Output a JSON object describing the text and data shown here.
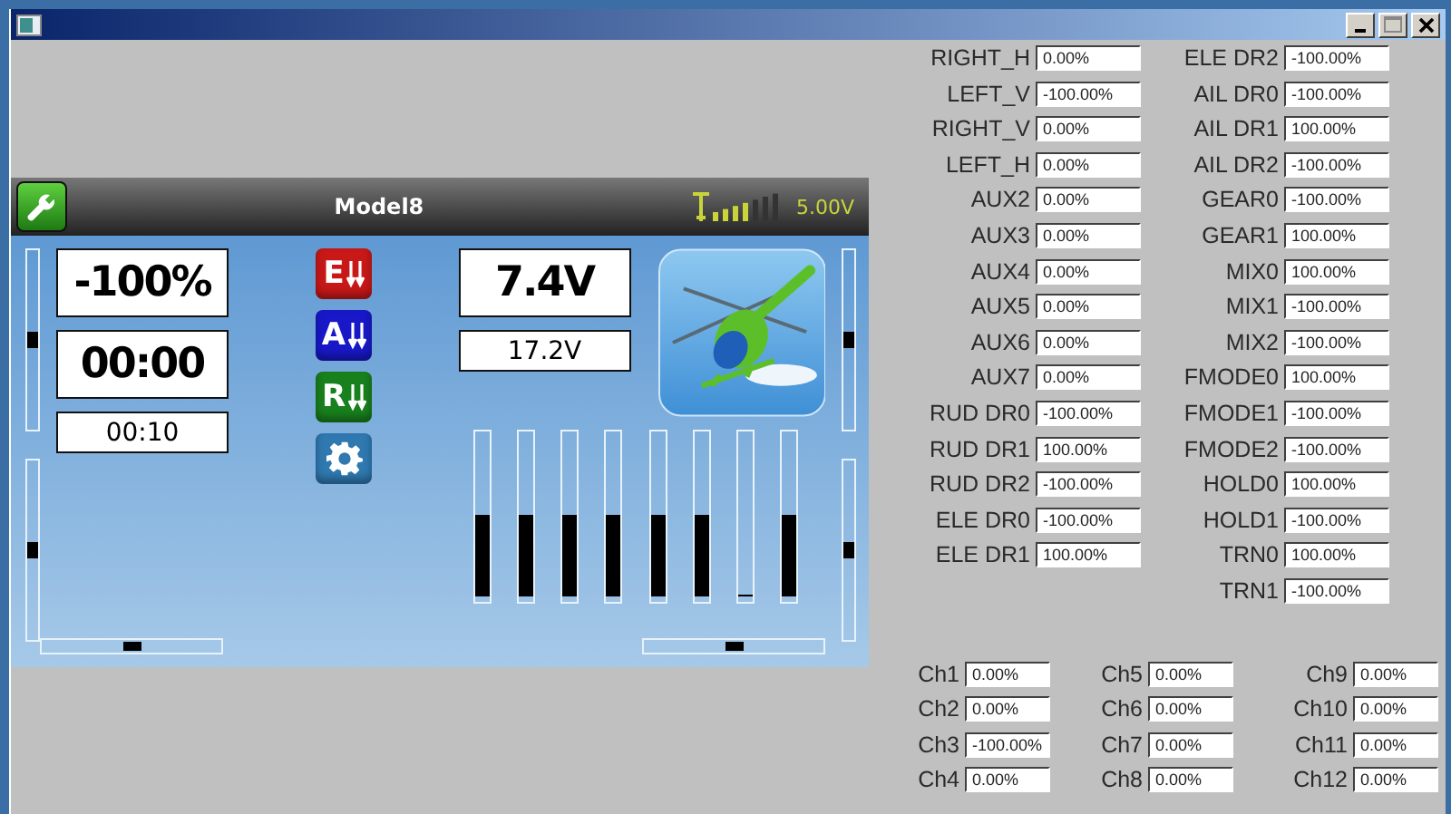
{
  "screen": {
    "model_name": "Model8",
    "tx_voltage": "5.00V",
    "readouts": [
      {
        "kind": "large",
        "text": "-100%"
      },
      {
        "kind": "large",
        "text": "00:00"
      },
      {
        "kind": "small",
        "text": "00:10"
      }
    ],
    "voltages": [
      {
        "kind": "large",
        "text": "7.4V"
      },
      {
        "kind": "small",
        "text": "17.2V"
      }
    ],
    "switch_icons": [
      {
        "kind": "letter",
        "letter": "E",
        "color": "#c81818"
      },
      {
        "kind": "letter",
        "letter": "A",
        "color": "#1818c8"
      },
      {
        "kind": "letter",
        "letter": "R",
        "color": "#18801c"
      },
      {
        "kind": "gear",
        "color": "#2f79b0"
      }
    ],
    "left_trims": [
      {
        "level": 0.5
      },
      {
        "level": 0.5
      }
    ],
    "left_horizontal_trim": {
      "level": 0.5
    },
    "right_trims": [
      {
        "level": 0.5
      },
      {
        "level": 0.5
      }
    ],
    "right_horizontal_trim": {
      "level": 0.5
    },
    "channel_bars": [
      {
        "level": 0.5
      },
      {
        "level": 0.5
      },
      {
        "level": 0.5
      },
      {
        "level": 0.5
      },
      {
        "level": 0.5
      },
      {
        "level": 0.5
      },
      {
        "level": 0
      },
      {
        "level": 0.5
      }
    ]
  },
  "inputs": {
    "column_1": [
      {
        "label": "RIGHT_H",
        "value": "0.00%"
      },
      {
        "label": "LEFT_V",
        "value": "-100.00%"
      },
      {
        "label": "RIGHT_V",
        "value": "0.00%"
      },
      {
        "label": "LEFT_H",
        "value": "0.00%"
      },
      {
        "label": "AUX2",
        "value": "0.00%"
      },
      {
        "label": "AUX3",
        "value": "0.00%"
      },
      {
        "label": "AUX4",
        "value": "0.00%"
      },
      {
        "label": "AUX5",
        "value": "0.00%"
      },
      {
        "label": "AUX6",
        "value": "0.00%"
      },
      {
        "label": "AUX7",
        "value": "0.00%"
      },
      {
        "label": "RUD DR0",
        "value": "-100.00%"
      },
      {
        "label": "RUD DR1",
        "value": "100.00%"
      },
      {
        "label": "RUD DR2",
        "value": "-100.00%"
      },
      {
        "label": "ELE DR0",
        "value": "-100.00%"
      },
      {
        "label": "ELE DR1",
        "value": "100.00%"
      }
    ],
    "column_2": [
      {
        "label": "ELE DR2",
        "value": "-100.00%"
      },
      {
        "label": "AIL DR0",
        "value": "-100.00%"
      },
      {
        "label": "AIL DR1",
        "value": "100.00%"
      },
      {
        "label": "AIL DR2",
        "value": "-100.00%"
      },
      {
        "label": "GEAR0",
        "value": "-100.00%"
      },
      {
        "label": "GEAR1",
        "value": "100.00%"
      },
      {
        "label": "MIX0",
        "value": "100.00%"
      },
      {
        "label": "MIX1",
        "value": "-100.00%"
      },
      {
        "label": "MIX2",
        "value": "-100.00%"
      },
      {
        "label": "FMODE0",
        "value": "100.00%"
      },
      {
        "label": "FMODE1",
        "value": "-100.00%"
      },
      {
        "label": "FMODE2",
        "value": "-100.00%"
      },
      {
        "label": "HOLD0",
        "value": "100.00%"
      },
      {
        "label": "HOLD1",
        "value": "-100.00%"
      },
      {
        "label": "TRN0",
        "value": "100.00%"
      },
      {
        "label": "TRN1",
        "value": "-100.00%"
      }
    ]
  },
  "channels": [
    [
      {
        "label": "Ch1",
        "value": "0.00%"
      },
      {
        "label": "Ch2",
        "value": "0.00%"
      },
      {
        "label": "Ch3",
        "value": "-100.00%"
      },
      {
        "label": "Ch4",
        "value": "0.00%"
      }
    ],
    [
      {
        "label": "Ch5",
        "value": "0.00%"
      },
      {
        "label": "Ch6",
        "value": "0.00%"
      },
      {
        "label": "Ch7",
        "value": "0.00%"
      },
      {
        "label": "Ch8",
        "value": "0.00%"
      }
    ],
    [
      {
        "label": "Ch9",
        "value": "0.00%"
      },
      {
        "label": "Ch10",
        "value": "0.00%"
      },
      {
        "label": "Ch11",
        "value": "0.00%"
      },
      {
        "label": "Ch12",
        "value": "0.00%"
      }
    ]
  ]
}
